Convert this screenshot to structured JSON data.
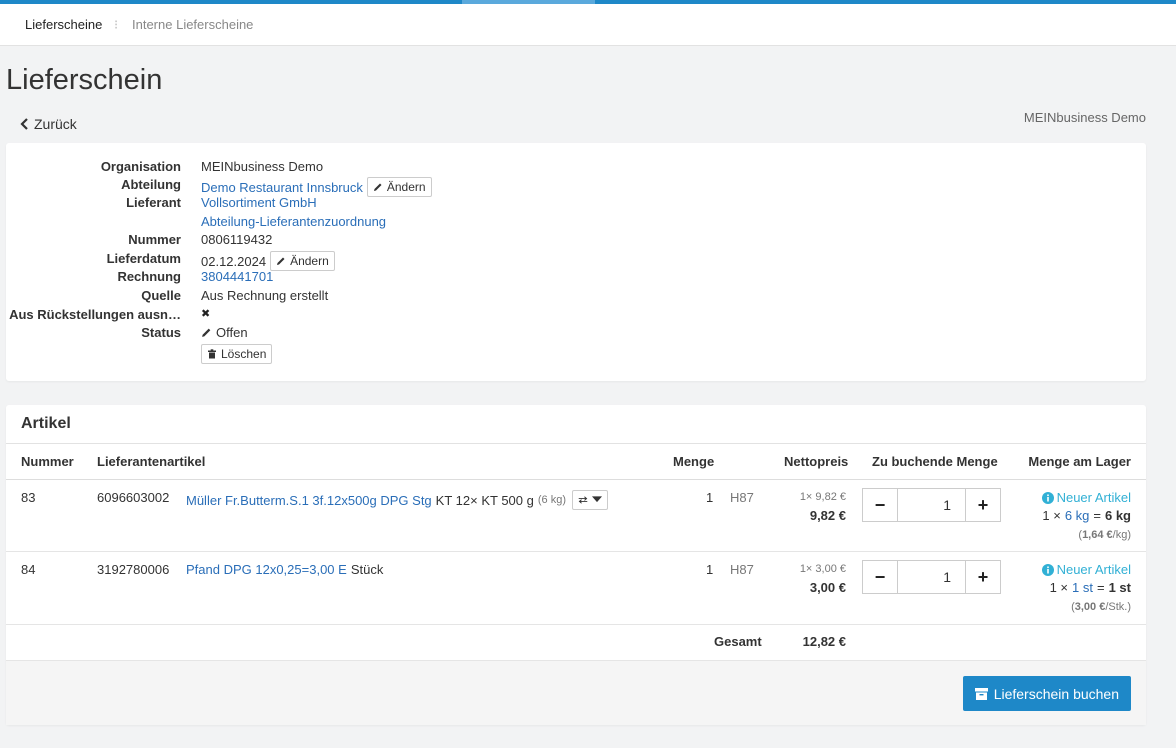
{
  "nav": {
    "active_tab": "Lieferscheine",
    "separator": "⁝",
    "inactive_tab": "Interne Lieferscheine"
  },
  "page": {
    "title": "Lieferschein",
    "back_label": "Zurück",
    "org_name": "MEINbusiness Demo"
  },
  "details": {
    "organisation_label": "Organisation",
    "organisation_value": "MEINbusiness Demo",
    "abteilung_label": "Abteilung",
    "abteilung_value": "Demo Restaurant Innsbruck",
    "lieferant_label": "Lieferant",
    "lieferant_value": "Vollsortiment GmbH",
    "zuordnung_link": "Abteilung-Lieferantenzuordnung",
    "nummer_label": "Nummer",
    "nummer_value": "0806119432",
    "lieferdatum_label": "Lieferdatum",
    "lieferdatum_value": "02.12.2024",
    "rechnung_label": "Rechnung",
    "rechnung_value": "3804441701",
    "quelle_label": "Quelle",
    "quelle_value": "Aus Rechnung erstellt",
    "rueck_label": "Aus Rückstellungen ausn…",
    "rueck_value": "✖",
    "status_label": "Status",
    "status_value": "Offen",
    "edit_label": "Ändern",
    "delete_label": "Löschen"
  },
  "articles": {
    "title": "Artikel",
    "headers": {
      "nummer": "Nummer",
      "lieferantenartikel": "Lieferantenartikel",
      "menge": "Menge",
      "nettopreis": "Nettopreis",
      "zu_buchen": "Zu buchende Menge",
      "lager": "Menge am Lager"
    },
    "rows": [
      {
        "nummer": "83",
        "article_no": "6096603002",
        "name_link": "Müller Fr.Butterm.S.1 3f.12x500g DPG Stg",
        "name_rest": "KT 12× KT 500 g",
        "weight": "(6 kg)",
        "qty": "1",
        "unit_code": "H87",
        "price_detail": "1× 9,82 €",
        "price": "9,82 €",
        "book_qty": "1",
        "new_article": "Neuer Artikel",
        "lager_prefix": "1 ×",
        "lager_unit_link": "6 kg",
        "lager_eq": "=",
        "lager_result": "6 kg",
        "unit_price_open": "(",
        "unit_price_value": "1,64 €",
        "unit_price_unit": "/kg)"
      },
      {
        "nummer": "84",
        "article_no": "3192780006",
        "name_link": "Pfand DPG 12x0,25=3,00 E",
        "name_rest": "Stück",
        "weight": "",
        "qty": "1",
        "unit_code": "H87",
        "price_detail": "1× 3,00 €",
        "price": "3,00 €",
        "book_qty": "1",
        "new_article": "Neuer Artikel",
        "lager_prefix": "1 ×",
        "lager_unit_link": "1 st",
        "lager_eq": "=",
        "lager_result": "1 st",
        "unit_price_open": "(",
        "unit_price_value": "3,00 €",
        "unit_price_unit": "/Stk.)"
      }
    ],
    "total_label": "Gesamt",
    "total_value": "12,82 €",
    "submit_label": "Lieferschein buchen"
  },
  "colors": {
    "primary": "#1e88c8",
    "link": "#2a6eb8",
    "info": "#31b0d5"
  }
}
